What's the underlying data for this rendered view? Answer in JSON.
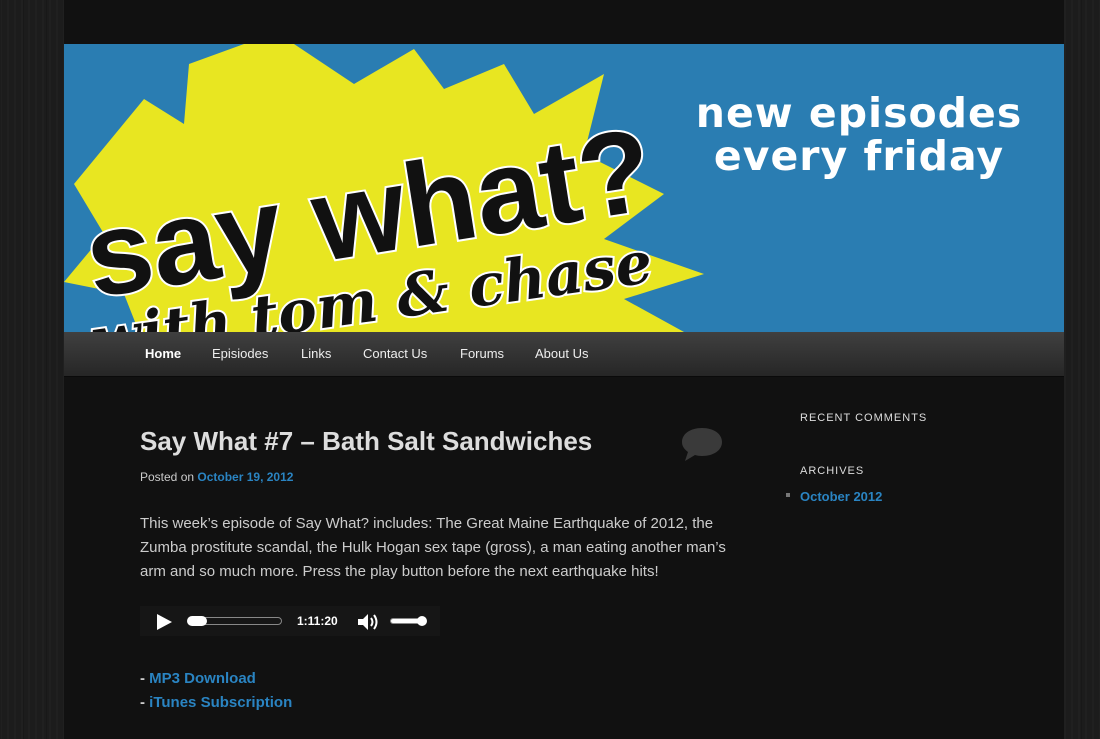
{
  "banner": {
    "logo_line1": "say what?",
    "logo_line2": "with tom & chase",
    "tagline_line1": "new episodes",
    "tagline_line2": "every friday",
    "bg_color": "#2a7db2",
    "burst_color": "#e8e621"
  },
  "nav": {
    "items": [
      {
        "label": "Home",
        "active": true
      },
      {
        "label": "Episiodes"
      },
      {
        "label": "Links"
      },
      {
        "label": "Contact Us"
      },
      {
        "label": "Forums"
      },
      {
        "label": "About Us"
      }
    ]
  },
  "post": {
    "title": "Say What #7 – Bath Salt Sandwiches",
    "posted_on_label": "Posted on",
    "date": "October 19, 2012",
    "body": "This week’s episode of Say What? includes: The Great Maine Earthquake of 2012, the Zumba prostitute scandal, the Hulk Hogan sex tape (gross), a man eating another man’s arm and so much more. Press the play button before the next earthquake hits!",
    "comment_icon": "speech-bubble-icon"
  },
  "player": {
    "play_icon": "play-icon",
    "duration": "1:11:20",
    "volume_icon": "speaker-icon",
    "progress_fraction": 0.0,
    "volume_fraction": 1.0
  },
  "downloads": {
    "dash": "-",
    "mp3_label": "MP3 Download",
    "itunes_label": "iTunes Subscription"
  },
  "sidebar": {
    "recent_comments_title": "RECENT COMMENTS",
    "archives_title": "ARCHIVES",
    "archives": [
      "October 2012"
    ]
  },
  "colors": {
    "link": "#2a84c2",
    "page_bg": "#111111",
    "text": "#cccccc"
  }
}
